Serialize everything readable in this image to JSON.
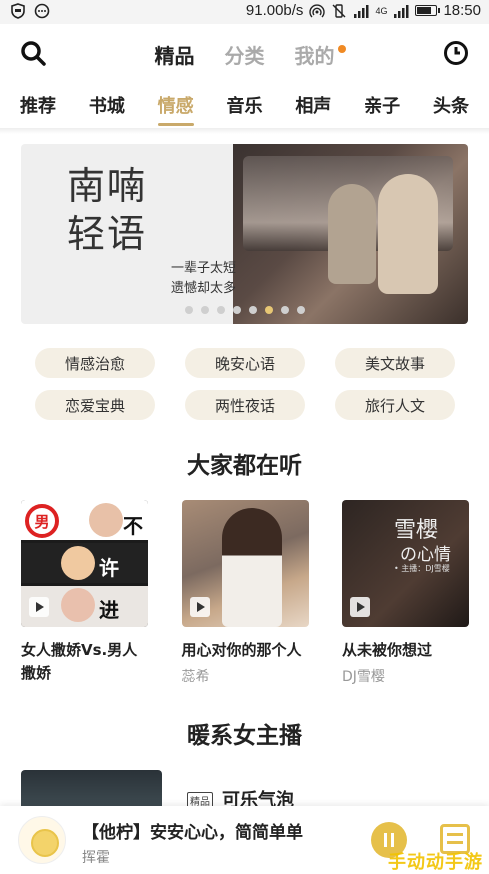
{
  "status_bar": {
    "speed": "91.00b/s",
    "network": "4G",
    "time": "18:50",
    "battery_level": 0.7
  },
  "top_nav": {
    "tabs": [
      {
        "label": "精品",
        "active": true
      },
      {
        "label": "分类",
        "active": false
      },
      {
        "label": "我的",
        "active": false,
        "badge_dot": true
      }
    ],
    "accent_color": "#f08a24"
  },
  "category_tabs": [
    {
      "label": "推荐",
      "active": false
    },
    {
      "label": "书城",
      "active": false
    },
    {
      "label": "情感",
      "active": true
    },
    {
      "label": "音乐",
      "active": false
    },
    {
      "label": "相声",
      "active": false
    },
    {
      "label": "亲子",
      "active": false
    },
    {
      "label": "头条",
      "active": false
    }
  ],
  "banner": {
    "title_line1": "南喃",
    "title_line2": "轻语",
    "subtitle_line1": "一辈子太短",
    "subtitle_line2": "遗憾却太多",
    "dot_count": 8,
    "active_dot": 5
  },
  "tags": [
    "情感治愈",
    "晚安心语",
    "美文故事",
    "恋爱宝典",
    "两性夜话",
    "旅行人文"
  ],
  "section_listening": {
    "title": "大家都在听",
    "cards": [
      {
        "title": "女人撒娇Vs.男人撒娇",
        "author": "",
        "cover_text": [
          "男",
          "不",
          "许",
          "进"
        ]
      },
      {
        "title": "用心对你的那个人",
        "author": "蕊希",
        "cover_text": []
      },
      {
        "title": "从未被你想过",
        "author": "DJ雪樱",
        "cover_text": [
          "雪櫻",
          "の心情",
          "• 主播：DJ雪樱"
        ]
      }
    ]
  },
  "section_anchors": {
    "title": "暖系女主播",
    "first_item": {
      "badge": "精品",
      "name": "可乐气泡"
    }
  },
  "player": {
    "title": "【他柠】安安心心，简简单单",
    "author": "挥霍",
    "accent_color": "#e6c04a"
  },
  "watermark": "手动动手游"
}
